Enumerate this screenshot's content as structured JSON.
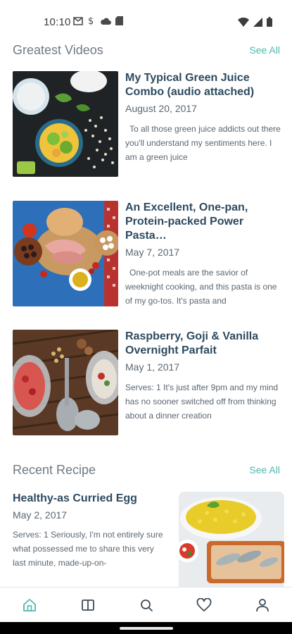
{
  "status_bar": {
    "time": "10:10"
  },
  "greatest_videos": {
    "title": "Greatest Videos",
    "see_all": "See All",
    "items": [
      {
        "title": "My Typical Green Juice Combo (audio attached)",
        "date": "August 20, 2017",
        "excerpt": "To all those green juice addicts out there you'll understand my sentiments here. I am a green juice"
      },
      {
        "title": "An Excellent, One-pan, Protein-packed Power Pasta…",
        "date": "May 7, 2017",
        "excerpt": "One-pot meals are the savior of weeknight cooking, and this pasta is one of my go-tos. It's pasta and"
      },
      {
        "title": "Raspberry, Goji & Vanilla Overnight Parfait",
        "date": "May 1, 2017",
        "excerpt": "Serves: 1 It's just after 9pm and my mind has no sooner switched off from thinking about a dinner creation"
      }
    ]
  },
  "recent_recipe": {
    "title": "Recent Recipe",
    "see_all": "See All",
    "item": {
      "title": "Healthy-as Curried Egg",
      "date": "May 2, 2017",
      "excerpt": "Serves: 1 Seriously, I'm not entirely sure what possessed me to share this very last minute, made-up-on-"
    }
  },
  "bottom_nav": {
    "items": [
      "home-icon",
      "book-icon",
      "search-icon",
      "heart-icon",
      "profile-icon"
    ],
    "active": "home-icon",
    "active_color": "#4fb8ae",
    "inactive_color": "#3c4a56"
  }
}
